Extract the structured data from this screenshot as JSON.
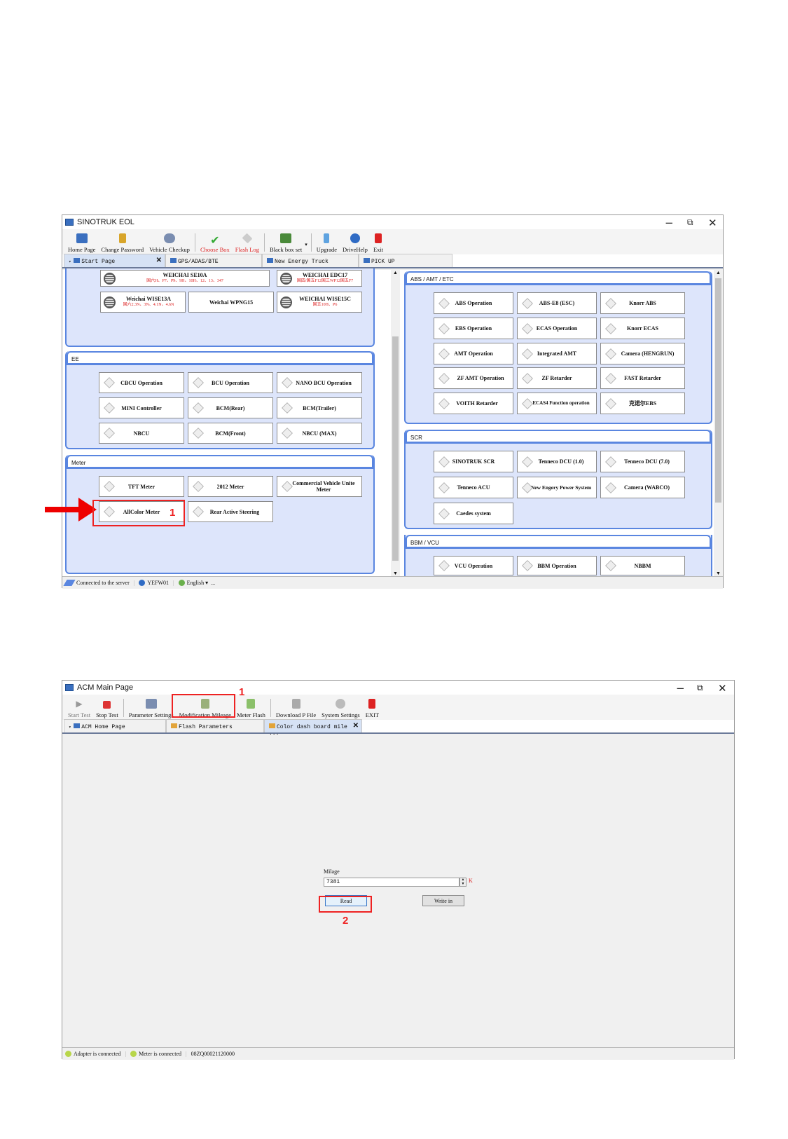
{
  "win1": {
    "title": "SINOTRUK EOL",
    "controls": [
      "−",
      "⧉",
      "✕"
    ],
    "toolbar": [
      "Home Page",
      "Change Password",
      "Vehicle Checkup",
      "Choose Box",
      "Flash Log",
      "Black box set",
      "Upgrade",
      "DriveHelp",
      "Exit"
    ],
    "tabs": [
      "Start Page",
      "GPS/ADAS/BTE",
      "New Energy Truck",
      "PICK UP"
    ],
    "weichai": {
      "b1": "WEICHAI SE10A",
      "b1_sub": "国六H、P7、P9、9H、10H、12、13、347",
      "b2": "WEICHAI EDC17",
      "b2_sub": "国四/国五F12国三WP12国五F7",
      "b3": "Weichai WISE13A",
      "b3_sub": "国六2.3N、3N、4.1N、4.6N",
      "b4": "Weichai WPNG15",
      "b5": "WEICHAI WISE15C",
      "b5_sub": "国五10H、P6"
    },
    "ee": {
      "header": "EE",
      "buttons": [
        "CBCU Operation",
        "BCU Operation",
        "NANO BCU Operation",
        "MINI Controller",
        "BCM(Rear)",
        "BCM(Trailer)",
        "NBCU",
        "BCM(Front)",
        "NBCU (MAX)"
      ]
    },
    "meter": {
      "header": "Meter",
      "buttons": [
        "TFT Meter",
        "2012 Meter",
        "Commercial Vehicle Unite Meter",
        "AllColor Meter",
        "Rear Active Steering"
      ]
    },
    "abs": {
      "header": "ABS / AMT / ETC",
      "buttons": [
        "ABS Operation",
        "ABS-E8 (ESC)",
        "Knorr ABS",
        "EBS Operation",
        "ECAS Operation",
        "Knorr ECAS",
        "AMT Operation",
        "Integrated AMT",
        "Camera (HENGRUN)",
        "ZF AMT Operation",
        "ZF Retarder",
        "FAST Retarder",
        "VOITH Retarder",
        "ECAS4 Function operation",
        "克诺尔EBS"
      ]
    },
    "scr": {
      "header": "SCR",
      "buttons": [
        "SINOTRUK SCR",
        "Tenneco DCU (1.0)",
        "Tenneco DCU (7.0)",
        "Tenneco ACU",
        "New Engery Power System",
        "Camera (WABCO)",
        "Caedes system"
      ]
    },
    "bbm": {
      "header": "BBM / VCU",
      "buttons": [
        "VCU Operation",
        "BBM Operation",
        "NBBM"
      ]
    },
    "status": [
      "Connected to the server",
      "YEFW01",
      "English ▾",
      "..."
    ],
    "marker": "1"
  },
  "win2": {
    "title": "ACM Main Page",
    "controls": [
      "−",
      "⧉",
      "✕"
    ],
    "toolbar": [
      "Start Test",
      "Stop Test",
      "Parameter Settings",
      "Modification Mileage",
      "Meter Flash",
      "Download P File",
      "System Settings",
      "EXIT"
    ],
    "tabs": [
      "ACM Home Page",
      "Flash Parameters",
      "Color dash board mile ..."
    ],
    "form": {
      "label": "Milage",
      "value": "7381",
      "unit": "K",
      "read": "Read",
      "write": "Write in"
    },
    "status": [
      "Adapter is connected",
      "Meter is connected",
      "08ZQ00021120000"
    ],
    "marker1": "1",
    "marker2": "2"
  },
  "colors": {
    "accent": "#5a86e0",
    "panel": "#dde5fb",
    "highlight": "#e22222"
  }
}
